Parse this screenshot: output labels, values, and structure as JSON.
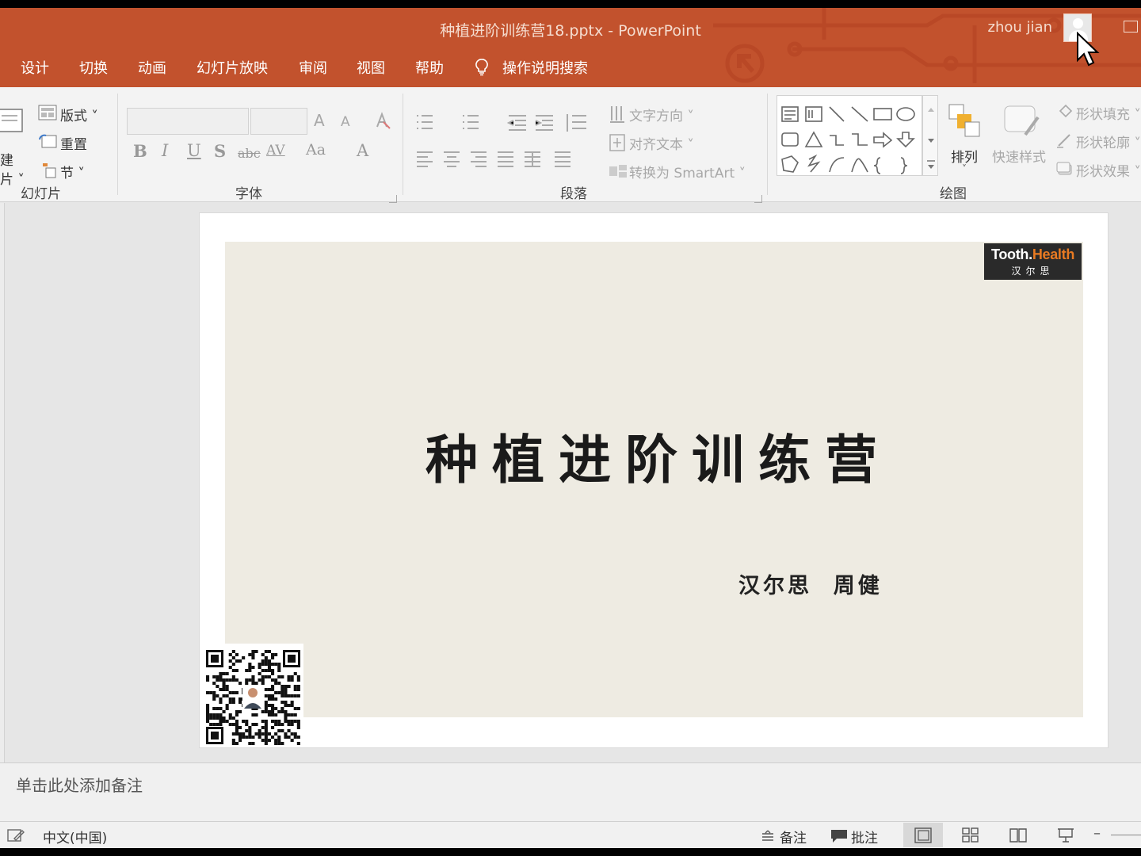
{
  "window": {
    "title": "种植进阶训练营18.pptx  -  PowerPoint",
    "user_name": "zhou jian"
  },
  "tabs": [
    "设计",
    "切换",
    "动画",
    "幻灯片放映",
    "审阅",
    "视图",
    "帮助"
  ],
  "tell_me": "操作说明搜索",
  "ribbon": {
    "slides_group": {
      "label": "幻灯片",
      "new_slide": "建",
      "new_slide_2": "片",
      "layout": "版式",
      "reset": "重置",
      "section": "节"
    },
    "font_group": {
      "label": "字体",
      "bold": "B",
      "italic": "I",
      "underline": "U",
      "shadow": "S",
      "strikethrough": "abc",
      "char_spacing": "AV",
      "change_case": "Aa",
      "font_color": "A",
      "grow": "A",
      "shrink": "A"
    },
    "paragraph_group": {
      "label": "段落",
      "text_direction": "文字方向",
      "align_text": "对齐文本",
      "convert_smartart": "转换为 SmartArt"
    },
    "drawing_group": {
      "label": "绘图",
      "arrange": "排列",
      "quick_styles": "快速样式",
      "shape_fill": "形状填充",
      "shape_outline": "形状轮廓",
      "shape_effects": "形状效果"
    }
  },
  "slide": {
    "title": "种植进阶训练营",
    "author": "汉尔思  周健",
    "logo_line1_a": "Tooth.",
    "logo_line1_b": "Health",
    "logo_line2": "汉尔思"
  },
  "notes": {
    "placeholder": "单击此处添加备注"
  },
  "statusbar": {
    "language": "中文(中国)",
    "notes": "备注",
    "comments": "批注"
  },
  "colors": {
    "accent": "#c2522d",
    "slide_background": "#eeebe2",
    "logo_accent": "#e87a22"
  }
}
